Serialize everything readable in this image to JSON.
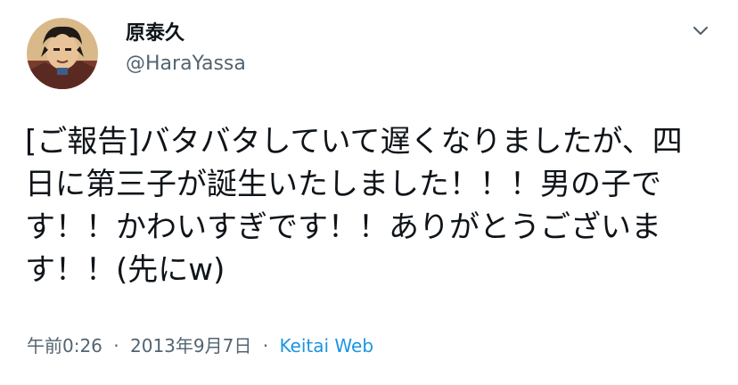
{
  "user": {
    "display_name": "原泰久",
    "handle": "@HaraYassa",
    "avatar_icon": "avatar-illustration"
  },
  "menu": {
    "icon": "chevron-down-icon"
  },
  "tweet": {
    "text": "[ご報告]バタバタしていて遅くなりましたが、四日に第三子が誕生いたしました！！！男の子です！！かわいすぎです！！ありがとうございます！！(先にw)"
  },
  "meta": {
    "time": "午前0:26",
    "separator": "·",
    "date": "2013年9月7日",
    "source": "Keitai Web"
  },
  "colors": {
    "text": "#0f1419",
    "secondary": "#536471",
    "link": "#1b95e0"
  }
}
